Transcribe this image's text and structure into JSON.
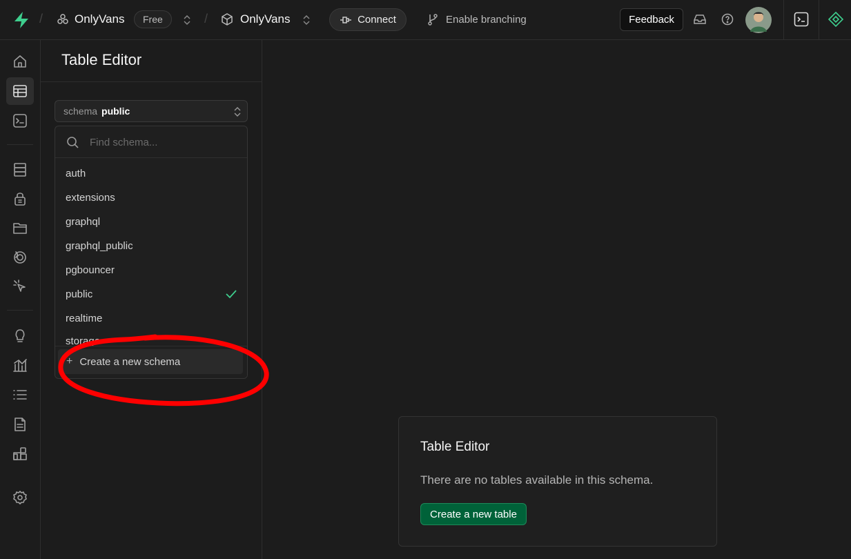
{
  "topbar": {
    "org_name": "OnlyVans",
    "plan_badge": "Free",
    "project_name": "OnlyVans",
    "connect_label": "Connect",
    "branching_label": "Enable branching",
    "feedback_label": "Feedback"
  },
  "sidebar": {
    "title": "Table Editor",
    "schema_label": "schema",
    "schema_value": "public"
  },
  "dropdown": {
    "search_placeholder": "Find schema...",
    "items": [
      "auth",
      "extensions",
      "graphql",
      "graphql_public",
      "pgbouncer",
      "public",
      "realtime"
    ],
    "partial_item": "storage",
    "selected": "public",
    "create_label": "Create a new schema"
  },
  "empty_state": {
    "title": "Table Editor",
    "message": "There are no tables available in this schema.",
    "button_label": "Create a new table"
  },
  "colors": {
    "brand": "#3ecf8e",
    "primary_button": "#006239",
    "annotation": "#ff0000"
  },
  "icons": {
    "rail": [
      "home-icon",
      "table-editor-icon",
      "sql-editor-icon",
      "database-icon",
      "auth-icon",
      "storage-icon",
      "realtime-icon",
      "edge-functions-icon",
      "advisors-icon",
      "reports-icon",
      "logs-icon",
      "api-docs-icon",
      "integrations-icon",
      "settings-icon"
    ]
  }
}
